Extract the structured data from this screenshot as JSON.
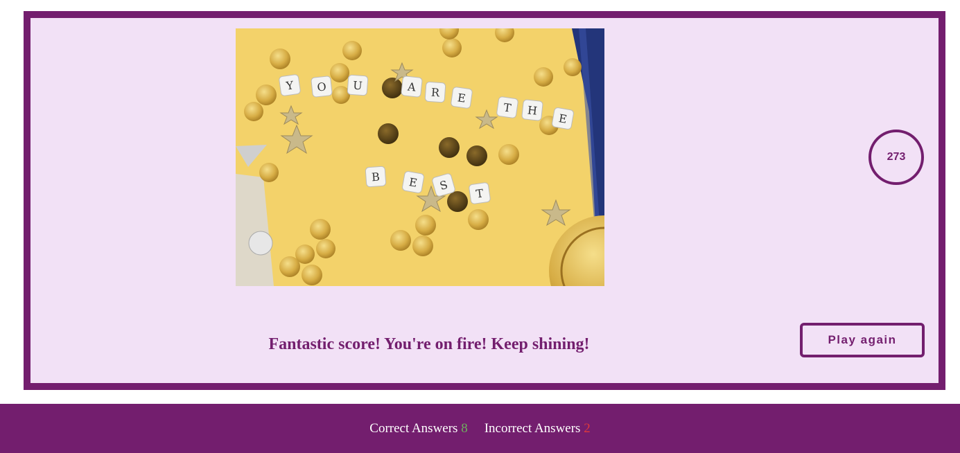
{
  "result": {
    "score": "273",
    "message": "Fantastic score! You're on fire! Keep shining!",
    "play_again_label": "Play again",
    "image": {
      "description_letters": [
        "Y",
        "O",
        "U",
        "A",
        "R",
        "E",
        "T",
        "H",
        "E",
        "B",
        "E",
        "S",
        "T"
      ]
    }
  },
  "footer": {
    "correct_label": "Correct Answers",
    "correct_value": "8",
    "incorrect_label": "Incorrect Answers",
    "incorrect_value": "2"
  },
  "colors": {
    "brand": "#731e6e",
    "card_bg": "#f2e1f6",
    "correct": "#6fae5f",
    "incorrect": "#e03a3a"
  }
}
